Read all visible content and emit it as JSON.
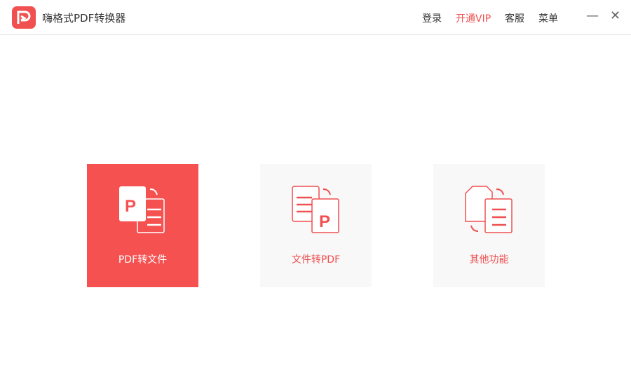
{
  "app": {
    "title": "嗨格式PDF转换器"
  },
  "nav": {
    "login": "登录",
    "vip": "开通VIP",
    "service": "客服",
    "menu": "菜单"
  },
  "colors": {
    "accent": "#f05050"
  },
  "cards": [
    {
      "label": "PDF转文件",
      "icon": "pdf-to-file-icon"
    },
    {
      "label": "文件转PDF",
      "icon": "file-to-pdf-icon"
    },
    {
      "label": "其他功能",
      "icon": "other-functions-icon"
    }
  ]
}
